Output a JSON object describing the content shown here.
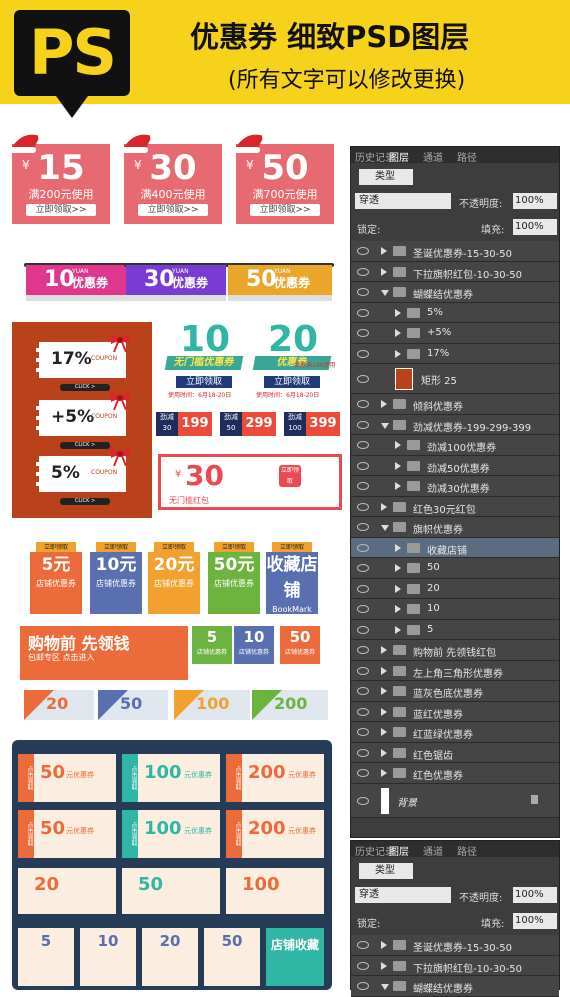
{
  "header": {
    "logo": "PS",
    "title": "优惠券  细致PSD图层",
    "subtitle": "(所有文字可以修改更换)"
  },
  "xmas": [
    {
      "value": "15",
      "cond": "满200元使用",
      "btn": "立即领取>>"
    },
    {
      "value": "30",
      "cond": "满400元使用",
      "btn": "立即领取>>"
    },
    {
      "value": "50",
      "cond": "满700元使用",
      "btn": "立即领取>>"
    }
  ],
  "yuan_sym": "¥",
  "ribbon": [
    {
      "value": "10",
      "label": "优惠券",
      "yuan": "YUAN",
      "color": "#e0378e"
    },
    {
      "value": "30",
      "label": "优惠券",
      "yuan": "YUAN",
      "color": "#7a3bd4"
    },
    {
      "value": "50",
      "label": "优惠券",
      "yuan": "YUAN",
      "color": "#e9a62b"
    }
  ],
  "bow": {
    "items": [
      "17%",
      "+5%",
      "5%"
    ],
    "coupon": "COUPON",
    "click": "CLICK >"
  },
  "green": [
    {
      "value": "10",
      "label": "无门槛优惠券",
      "btn": "立即领取"
    },
    {
      "value": "20",
      "label": "优惠券",
      "note": "单笔满199使用",
      "btn": "立即领取"
    }
  ],
  "green_date": "使用时间：6月18-20日",
  "strip": [
    {
      "left": "劲减\n30",
      "value": "199"
    },
    {
      "left": "劲减\n50",
      "value": "299"
    },
    {
      "left": "劲减\n100",
      "value": "399"
    }
  ],
  "red30": {
    "value": "30",
    "sub": "无门槛红包",
    "btn": "立即领取"
  },
  "shop": [
    {
      "top": "立即领取",
      "value": "5",
      "unit": "元",
      "label": "店铺优惠券",
      "color": "#ec6b3a"
    },
    {
      "top": "立即领取",
      "value": "10",
      "unit": "元",
      "label": "店铺优惠券",
      "color": "#5a6fb0"
    },
    {
      "top": "立即领取",
      "value": "20",
      "unit": "元",
      "label": "店铺优惠券",
      "color": "#f2a12e"
    },
    {
      "top": "立即领取",
      "value": "50",
      "unit": "元",
      "label": "店铺优惠券",
      "color": "#6db33f"
    },
    {
      "top": "立即领取",
      "value": "收藏",
      "unit": "店铺",
      "label": "BookMark",
      "color": "#5a6fb0"
    }
  ],
  "shopping": {
    "title": "购物前 先领钱",
    "sub": "包邮专区  点击进入",
    "items": [
      {
        "value": "5",
        "label": "店铺优惠券",
        "color": "#6db33f"
      },
      {
        "value": "10",
        "label": "店铺优惠券",
        "color": "#5a6fb0"
      },
      {
        "value": "50",
        "label": "店铺优惠券",
        "color": "#ec6b3a"
      }
    ]
  },
  "tri": [
    {
      "value": "20",
      "color": "#ec6b3a"
    },
    {
      "value": "50",
      "color": "#5a6fb0"
    },
    {
      "value": "100",
      "color": "#f2a12e"
    },
    {
      "value": "200",
      "color": "#6db33f"
    }
  ],
  "navy": {
    "click": "点击领取",
    "rows": [
      [
        "50",
        "100",
        "200"
      ],
      [
        "50",
        "100",
        "200"
      ]
    ],
    "unit": "元优惠券",
    "row3": [
      "20",
      "50",
      "100"
    ],
    "row4": [
      "5",
      "10",
      "20",
      "50"
    ],
    "fav": "店铺收藏"
  },
  "panel1": {
    "tabs": [
      "历史记录",
      "图层",
      "通道",
      "路径"
    ],
    "kind": "类型",
    "blend": "穿透",
    "opacity_label": "不透明度:",
    "opacity": "100%",
    "lock": "锁定:",
    "fill_label": "填充:",
    "fill": "100%",
    "layers": [
      {
        "name": "圣诞优惠券-15-30-50",
        "lvl": 0,
        "open": false
      },
      {
        "name": "下拉旗帜红包-10-30-50",
        "lvl": 0,
        "open": false
      },
      {
        "name": "蝴蝶结优惠券",
        "lvl": 0,
        "open": true
      },
      {
        "name": "5%",
        "lvl": 1,
        "open": false
      },
      {
        "name": "+5%",
        "lvl": 1,
        "open": false
      },
      {
        "name": "17%",
        "lvl": 1,
        "open": false
      },
      {
        "name": "矩形 25",
        "lvl": 1,
        "shape": true
      },
      {
        "name": "倾斜优惠券",
        "lvl": 0,
        "open": false
      },
      {
        "name": "劲减优惠券-199-299-399",
        "lvl": 0,
        "open": true
      },
      {
        "name": "劲减100优惠券",
        "lvl": 1,
        "open": false
      },
      {
        "name": "劲减50优惠券",
        "lvl": 1,
        "open": false
      },
      {
        "name": "劲减30优惠券",
        "lvl": 1,
        "open": false
      },
      {
        "name": "红色30元红包",
        "lvl": 0,
        "open": false
      },
      {
        "name": "旗帜优惠券",
        "lvl": 0,
        "open": true
      },
      {
        "name": "收藏店铺",
        "lvl": 1,
        "open": false,
        "sel": true
      },
      {
        "name": "50",
        "lvl": 1,
        "open": false
      },
      {
        "name": "20",
        "lvl": 1,
        "open": false
      },
      {
        "name": "10",
        "lvl": 1,
        "open": false
      },
      {
        "name": "5",
        "lvl": 1,
        "open": false
      },
      {
        "name": "购物前 先领钱红包",
        "lvl": 0,
        "open": false
      },
      {
        "name": "左上角三角形优惠券",
        "lvl": 0,
        "open": false
      },
      {
        "name": "蓝灰色底优惠券",
        "lvl": 0,
        "open": false
      },
      {
        "name": "蓝红优惠券",
        "lvl": 0,
        "open": false
      },
      {
        "name": "红蓝绿优惠券",
        "lvl": 0,
        "open": false
      },
      {
        "name": "红色锯齿",
        "lvl": 0,
        "open": false
      },
      {
        "name": "红色优惠券",
        "lvl": 0,
        "open": false
      },
      {
        "name": "背景",
        "lvl": 0,
        "bg": true
      }
    ]
  },
  "panel2": {
    "tabs": [
      "历史记录",
      "图层",
      "通道",
      "路径"
    ],
    "kind": "类型",
    "blend": "穿透",
    "opacity_label": "不透明度:",
    "opacity": "100%",
    "lock": "锁定:",
    "fill_label": "填充:",
    "fill": "100%",
    "layers": [
      {
        "name": "圣诞优惠券-15-30-50",
        "lvl": 0,
        "open": false
      },
      {
        "name": "下拉旗帜红包-10-30-50",
        "lvl": 0,
        "open": false
      },
      {
        "name": "蝴蝶结优惠券",
        "lvl": 0,
        "open": true
      }
    ]
  }
}
